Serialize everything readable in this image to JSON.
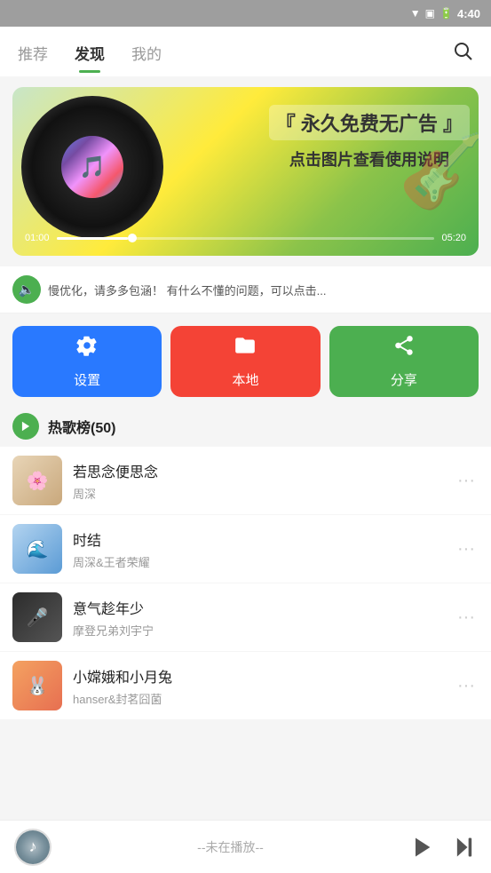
{
  "statusBar": {
    "time": "4:40",
    "batteryIcon": "🔋",
    "signalIcon": "▼",
    "wifiIcon": "📶"
  },
  "nav": {
    "tabs": [
      "推荐",
      "发现",
      "我的"
    ],
    "activeTab": 1,
    "searchLabel": "search"
  },
  "banner": {
    "title": "『 永久免费无广告 』",
    "subtitle": "点击图片查看使用说明",
    "progressStart": "01:00",
    "progressEnd": "05:20",
    "progressPercent": 19
  },
  "notification": {
    "icon": "🔈",
    "text": "慢优化，请多多包涵！  有什么不懂的问题，可以点击..."
  },
  "actionButtons": [
    {
      "id": "settings",
      "label": "设置",
      "icon": "gear"
    },
    {
      "id": "local",
      "label": "本地",
      "icon": "folder"
    },
    {
      "id": "share",
      "label": "分享",
      "icon": "share"
    }
  ],
  "hotList": {
    "title": "热歌榜",
    "count": "(50)"
  },
  "songs": [
    {
      "id": 1,
      "name": "若思念便思念",
      "artist": "周深",
      "coverClass": "cover-1"
    },
    {
      "id": 2,
      "name": "时结",
      "artist": "周深&王者荣耀",
      "coverClass": "cover-2"
    },
    {
      "id": 3,
      "name": "意气趁年少",
      "artist": "摩登兄弟刘宇宁",
      "coverClass": "cover-3"
    },
    {
      "id": 4,
      "name": "小嫦娥和小月兔",
      "artist": "hanser&封茗囧菌",
      "coverClass": "cover-4"
    }
  ],
  "bottomPlayer": {
    "status": "--未在播放--",
    "playIcon": "play",
    "nextIcon": "skip-next"
  }
}
